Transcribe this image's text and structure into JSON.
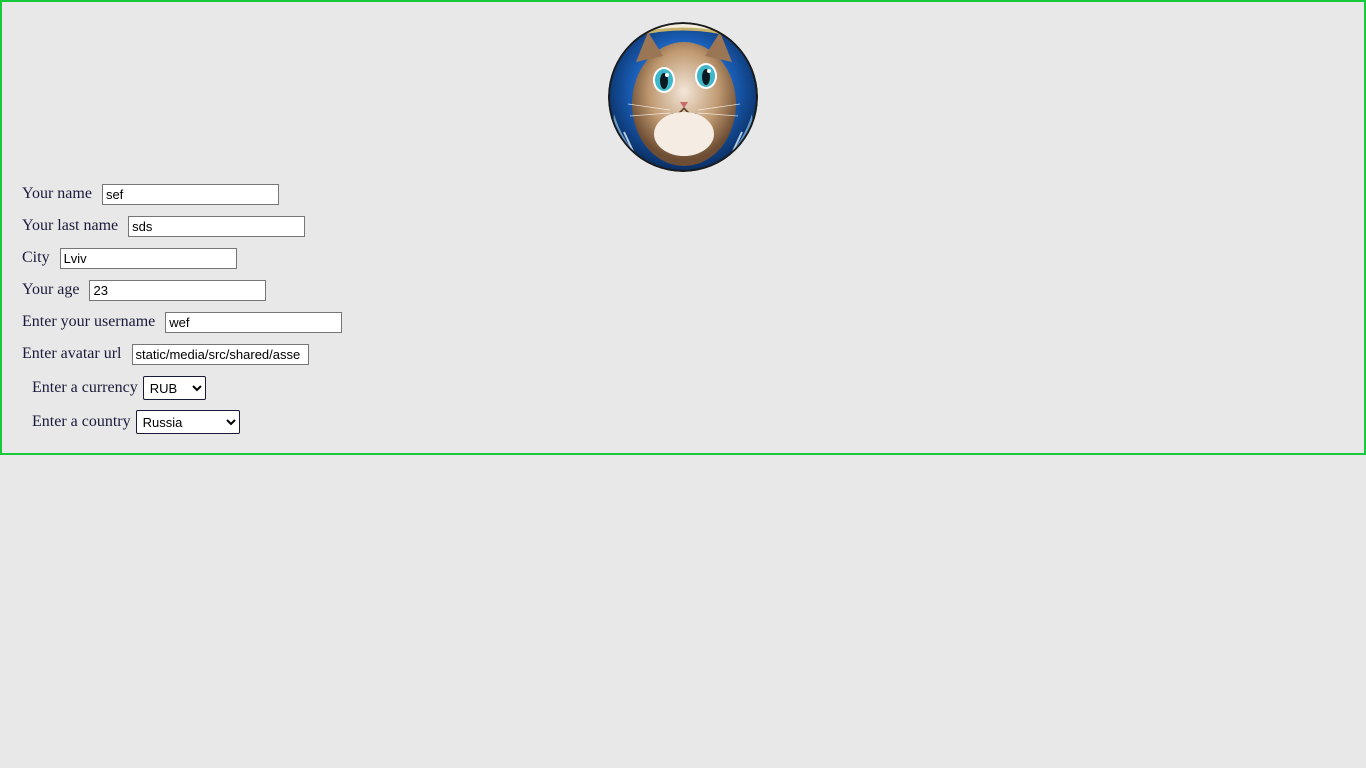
{
  "avatar": {
    "icon": "cat-astronaut-avatar",
    "colors": {
      "helmet": "#1a5fb8",
      "fur": "#b08a64",
      "eyes": "#3fb7c9",
      "border": "#1b1b1b"
    }
  },
  "form": {
    "fields": [
      {
        "label": "Your name",
        "value": "sef"
      },
      {
        "label": "Your last name",
        "value": "sds"
      },
      {
        "label": "City",
        "value": "Lviv"
      },
      {
        "label": "Your age",
        "value": "23"
      },
      {
        "label": "Enter your username",
        "value": "wef"
      },
      {
        "label": "Enter avatar url",
        "value": "static/media/src/shared/asse"
      }
    ],
    "currency": {
      "label": "Enter a currency",
      "selected": "RUB"
    },
    "country": {
      "label": "Enter a country",
      "selected": "Russia"
    }
  },
  "theme": {
    "border": "#16c93a",
    "background": "#e8e8e8",
    "text": "#1a1a3a"
  }
}
